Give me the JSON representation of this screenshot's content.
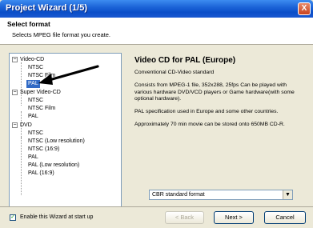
{
  "window": {
    "title": "Project Wizard (1/5)",
    "close_glyph": "X"
  },
  "header": {
    "title": "Select format",
    "subtitle": "Selects MPEG file format you create."
  },
  "tree": [
    {
      "label": "Video-CD",
      "expander": "−",
      "children": [
        "NTSC",
        "NTSC Film",
        "PAL"
      ]
    },
    {
      "label": "Super Video-CD",
      "expander": "−",
      "children": [
        "NTSC",
        "NTSC Film",
        "PAL"
      ]
    },
    {
      "label": "DVD",
      "expander": "−",
      "children": [
        "NTSC",
        "NTSC (Low resolution)",
        "NTSC (16:9)",
        "PAL",
        "PAL (Low resolution)",
        "PAL (16:9)"
      ]
    }
  ],
  "tree_selected": "PAL",
  "description": {
    "title": "Video CD for PAL (Europe)",
    "line1": "Conventional CD-Video standard",
    "line2": "Consists from MPEG-1 file, 352x288, 25fps Can be played with various hardware DVD/VCD players or Game hardware(with some optional hardware).",
    "line3": "PAL specification used in Europe and some other countries.",
    "line4": "Approximately 70 min movie can be stored onto 650MB CD-R."
  },
  "encoding_select": {
    "value": "CBR   standard format",
    "arrow": "▼"
  },
  "startup_checkbox": {
    "label": "Enable this Wizard at start up",
    "checked": true,
    "mark": "✓"
  },
  "buttons": {
    "back": "< Back",
    "next": "Next >",
    "cancel": "Cancel"
  },
  "colors": {
    "title_bar": "#1c64d8",
    "selection": "#316ac5",
    "dialog_bg": "#ece9d8"
  }
}
